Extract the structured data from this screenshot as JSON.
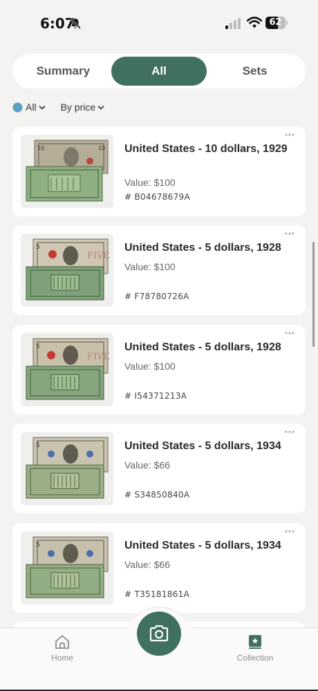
{
  "status": {
    "time": "6:07",
    "battery": "62",
    "battery_level": 0.62
  },
  "tabs": [
    {
      "label": "Summary",
      "active": false
    },
    {
      "label": "All",
      "active": true
    },
    {
      "label": "Sets",
      "active": false
    }
  ],
  "filters": {
    "region": "All",
    "sort": "By price"
  },
  "items": [
    {
      "title": "United States - 10 dollars, 1929",
      "value": "Value: $100",
      "serial": "# B04678679A",
      "note": "10"
    },
    {
      "title": "United States - 5 dollars, 1928",
      "value": "Value: $100",
      "serial": "# F78780726A",
      "note": "5red"
    },
    {
      "title": "United States - 5 dollars, 1928",
      "value": "Value: $100",
      "serial": "# I54371213A",
      "note": "5red"
    },
    {
      "title": "United States - 5 dollars, 1934",
      "value": "Value: $66",
      "serial": "# S34850840A",
      "note": "5blue"
    },
    {
      "title": "United States - 5 dollars, 1934",
      "value": "Value: $66",
      "serial": "# T35181861A",
      "note": "5blue"
    }
  ],
  "tabbar": {
    "home": "Home",
    "collection": "Collection"
  },
  "colors": {
    "accent": "#40705f",
    "background": "#f3f3f1"
  }
}
